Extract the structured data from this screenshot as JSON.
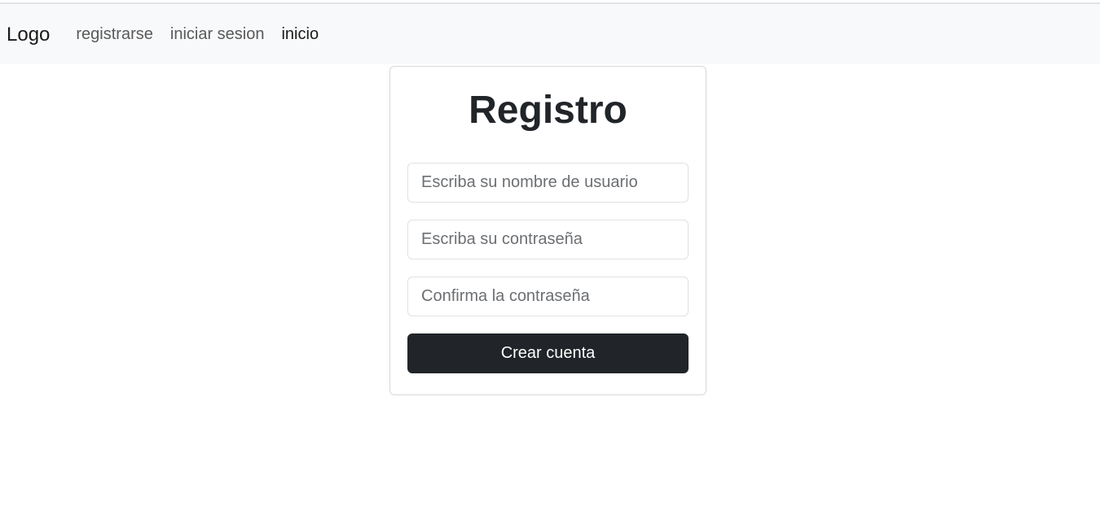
{
  "navbar": {
    "brand": "Logo",
    "links": [
      {
        "label": "registrarse"
      },
      {
        "label": "iniciar sesion"
      },
      {
        "label": "inicio"
      }
    ]
  },
  "form": {
    "title": "Registro",
    "username": {
      "placeholder": "Escriba su nombre de usuario",
      "value": ""
    },
    "password": {
      "placeholder": "Escriba su contraseña",
      "value": ""
    },
    "confirm": {
      "placeholder": "Confirma la contraseña",
      "value": ""
    },
    "submit_label": "Crear cuenta"
  },
  "colors": {
    "navbar_bg": "#f8f9fa",
    "button_bg": "#212529",
    "button_text": "#ffffff"
  }
}
